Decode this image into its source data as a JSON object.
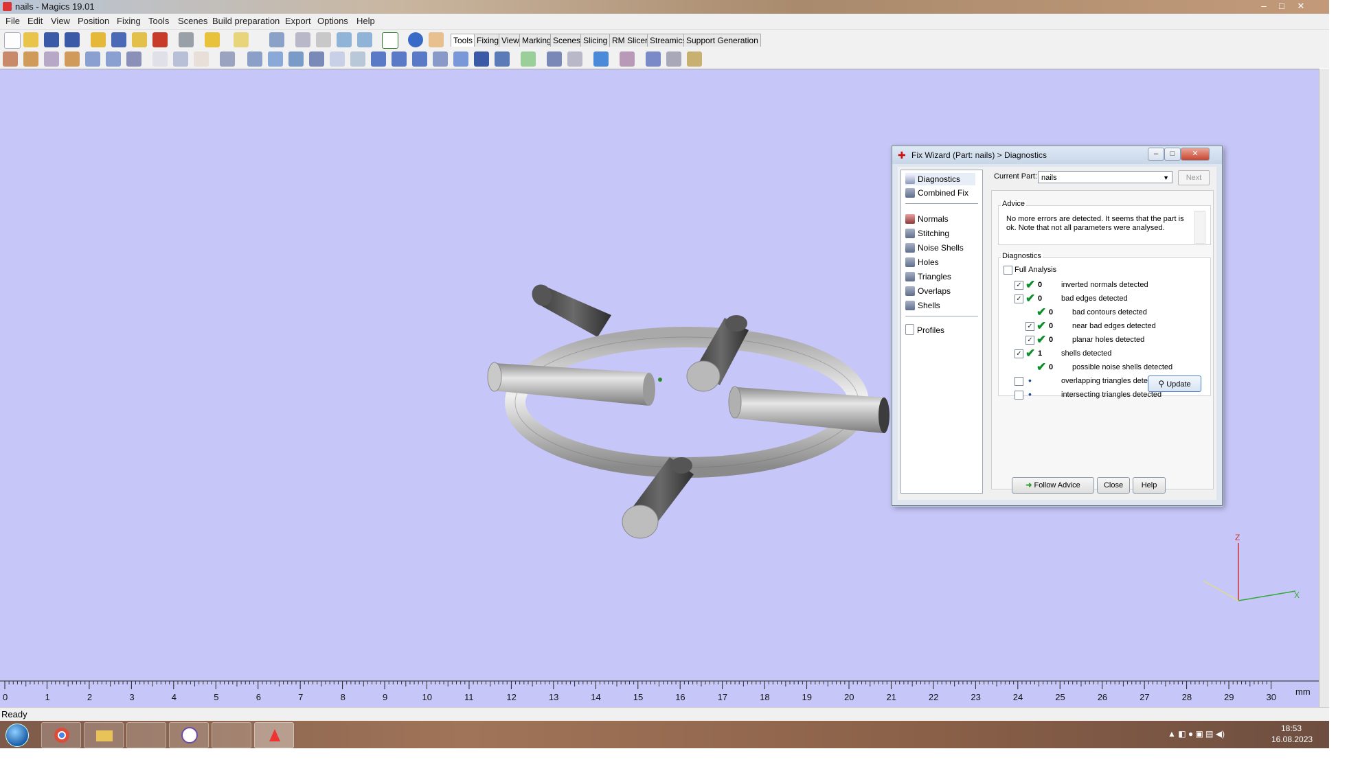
{
  "window": {
    "title": "nails - Magics 19.01",
    "controls": [
      "–",
      "□",
      "✕"
    ]
  },
  "menu": [
    "File",
    "Edit",
    "View",
    "Position",
    "Fixing",
    "Tools",
    "Scenes",
    "Build preparation",
    "Export",
    "Options",
    "Help"
  ],
  "toolbar_tabs": [
    "Tools",
    "Fixing",
    "View",
    "Marking",
    "Scenes",
    "Slicing",
    "RM Slicer",
    "Streamics",
    "Support Generation"
  ],
  "active_tab": "Tools",
  "ruler": {
    "labels": [
      "0",
      "1",
      "2",
      "3",
      "4",
      "5",
      "6",
      "7",
      "8",
      "9",
      "10",
      "11",
      "12",
      "13",
      "14",
      "15",
      "16",
      "17",
      "18",
      "19",
      "20",
      "21",
      "22",
      "23",
      "24",
      "25",
      "26",
      "27",
      "28",
      "29",
      "30"
    ],
    "unit": "mm"
  },
  "axes": {
    "z": "Z",
    "x": "X"
  },
  "status": "Ready",
  "taskbar": {
    "time": "18:53",
    "date": "16.08.2023",
    "apps": [
      "chrome-icon",
      "explorer-icon",
      "paint-icon",
      "viber-icon",
      "cad-icon",
      "magics-icon"
    ]
  },
  "dialog": {
    "title": "Fix Wizard (Part: nails) > Diagnostics",
    "nav_top": [
      "Diagnostics",
      "Combined Fix"
    ],
    "nav_tools": [
      "Normals",
      "Stitching",
      "Noise Shells",
      "Holes",
      "Triangles",
      "Overlaps",
      "Shells"
    ],
    "nav_bottom": [
      "Profiles"
    ],
    "current_part_label": "Current Part:",
    "current_part_value": "nails",
    "next_label": "Next",
    "advice_caption": "Advice",
    "advice_text": "No more errors are detected. It seems that the part is ok. Note that not all parameters were analysed.",
    "diagnostics_caption": "Diagnostics",
    "full_analysis_label": "Full Analysis",
    "diag_rows": [
      {
        "count": "0",
        "label": "inverted normals detected",
        "checked": true,
        "status": "ok",
        "indent": 0
      },
      {
        "count": "0",
        "label": "bad edges detected",
        "checked": true,
        "status": "ok",
        "indent": 0
      },
      {
        "count": "0",
        "label": "bad contours detected",
        "checked": null,
        "status": "ok",
        "indent": 1
      },
      {
        "count": "0",
        "label": "near bad edges detected",
        "checked": true,
        "status": "ok",
        "indent": 1
      },
      {
        "count": "0",
        "label": "planar holes detected",
        "checked": true,
        "status": "ok",
        "indent": 1
      },
      {
        "count": "1",
        "label": "shells detected",
        "checked": true,
        "status": "ok",
        "indent": 0
      },
      {
        "count": "0",
        "label": "possible noise shells detected",
        "checked": null,
        "status": "ok",
        "indent": 1
      },
      {
        "count": "",
        "label": "overlapping triangles detected",
        "checked": false,
        "status": "dot",
        "indent": 0
      },
      {
        "count": "",
        "label": "intersecting triangles detected",
        "checked": false,
        "status": "dot",
        "indent": 0
      }
    ],
    "update_label": "Update",
    "follow_advice_label": "Follow Advice",
    "close_label": "Close",
    "help_label": "Help"
  }
}
